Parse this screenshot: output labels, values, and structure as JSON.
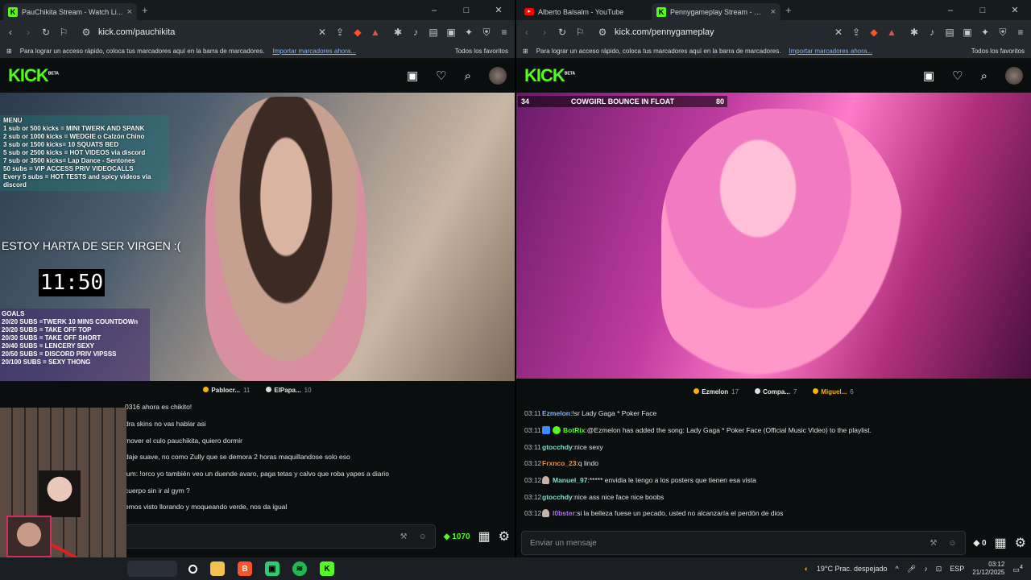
{
  "left": {
    "tab_title": "PauChikita Stream - Watch Li...",
    "url": "kick.com/pauchikita",
    "bookmarks_text": "Para lograr un acceso rápido, coloca tus marcadores aquí en la barra de marcadores.",
    "bookmarks_link": "Importar marcadores ahora...",
    "bookmarks_all": "Todos los favoritos",
    "logo": "KICK",
    "logo_beta": "BETA",
    "overlay_menu": [
      "MENU",
      "1 sub or 500 kicks = MINI TWERK AND SPANK",
      "2 sub or 1000 kicks = WEDGIE o Calzón Chino",
      "3 sub or 1500 kicks= 10 SQUATS BED",
      "",
      "5 sub or 2500 kicks = HOT VIDEOS via discord",
      "7 sub or 3500 kicks= Lap Dance - Sentones",
      "",
      "50 subs = VIP ACCESS PRIV VIDEOCALLS",
      "",
      "Every 5 subs = HOT TESTS and spicy videos via discord"
    ],
    "overlay_estoy": "ESTOY HARTA DE SER VIRGEN :(",
    "overlay_clock": "11:50",
    "overlay_goals": [
      "GOALS",
      "",
      "20/20 SUBS =TWERK 10 MINS COUNTDOWn",
      "20/20 SUBS = TAKE OFF TOP",
      "20/30 SUBS = TAKE OFF SHORT",
      "20/40 SUBS = LENCERY SEXY",
      "",
      "20/50 SUBS = DISCORD PRIV VIPSSS",
      "20/100 SUBS = SEXY THONG"
    ],
    "top_viewers": [
      {
        "name": "Pablocr...",
        "count": "11",
        "color": "#f5b400"
      },
      {
        "name": "ElPapa...",
        "count": "10",
        "color": "#e0e0e0"
      }
    ],
    "chat": [
      {
        "msg": "0316 ahora es chikito!"
      },
      {
        "msg": "dra skins no vas hablar asi"
      },
      {
        "msg": "mover el culo pauchikita, quiero dormir"
      },
      {
        "msg": "daje suave, no como Zully que se demora 2 horas maquillandose solo eso"
      },
      {
        "msg": "ium: !orco yo también veo un duende avaro, paga tetas y calvo que roba yapes a diario"
      },
      {
        "msg": "cuerpo sin ir al gym ?"
      },
      {
        "msg": "emos visto llorando y moqueando verde, nos da igual"
      }
    ],
    "kicks": "1070"
  },
  "right": {
    "tab1_title": "Alberto Balsalm - YouTube",
    "tab2_title": "Pennygameplay Stream - Wat...",
    "url": "kick.com/pennygameplay",
    "bookmarks_text": "Para lograr un acceso rápido, coloca tus marcadores aquí en la barra de marcadores.",
    "bookmarks_link": "Importar marcadores ahora...",
    "bookmarks_all": "Todos los favoritos",
    "logo": "KICK",
    "logo_beta": "BETA",
    "poll": {
      "left": "34",
      "question": "COWGIRL BOUNCE IN FLOAT",
      "right": "80"
    },
    "top_viewers": [
      {
        "name": "Ezmelon",
        "count": "17",
        "color": "#f5b400"
      },
      {
        "name": "Compa...",
        "count": "7",
        "color": "#e0e0e0"
      },
      {
        "name": "Miguel...",
        "count": "6",
        "color": "#f5b400"
      }
    ],
    "chat": [
      {
        "ts": "03:11",
        "name": "Ezmelon",
        "color": "#8ab4f8",
        "badge": "",
        "msg": "!sr Lady Gaga * Poker Face"
      },
      {
        "ts": "03:11",
        "name": "BotRix",
        "color": "#53fc18",
        "badge": "bot",
        "msg": "@Ezmelon has added the song: Lady Gaga * Poker Face (Official Music Video) to the playlist."
      },
      {
        "ts": "03:11",
        "name": "gtocchdy",
        "color": "#7ee0c0",
        "badge": "",
        "msg": "nice sexy"
      },
      {
        "ts": "03:12",
        "name": "Frxnco_23",
        "color": "#ff8c3a",
        "badge": "",
        "msg": "q lindo"
      },
      {
        "ts": "03:12",
        "name": "Manuel_97",
        "color": "#7ee0c0",
        "badge": "user",
        "msg": "***** envidia le tengo a los posters que tienen esa vista"
      },
      {
        "ts": "03:12",
        "name": "gtocchdy",
        "color": "#7ee0c0",
        "badge": "",
        "msg": "nice ass nice face nice boobs"
      },
      {
        "ts": "03:12",
        "name": "l0bster",
        "color": "#b36bff",
        "badge": "user",
        "msg": "si la belleza fuese un pecado, usted no alcanzaría el perdón de dios"
      }
    ],
    "input_placeholder": "Enviar un mensaje",
    "kicks": "0"
  },
  "taskbar": {
    "weather": "19°C  Prac. despejado",
    "lang": "ESP",
    "time": "03:12",
    "date": "21/12/2025",
    "notif": "4"
  }
}
